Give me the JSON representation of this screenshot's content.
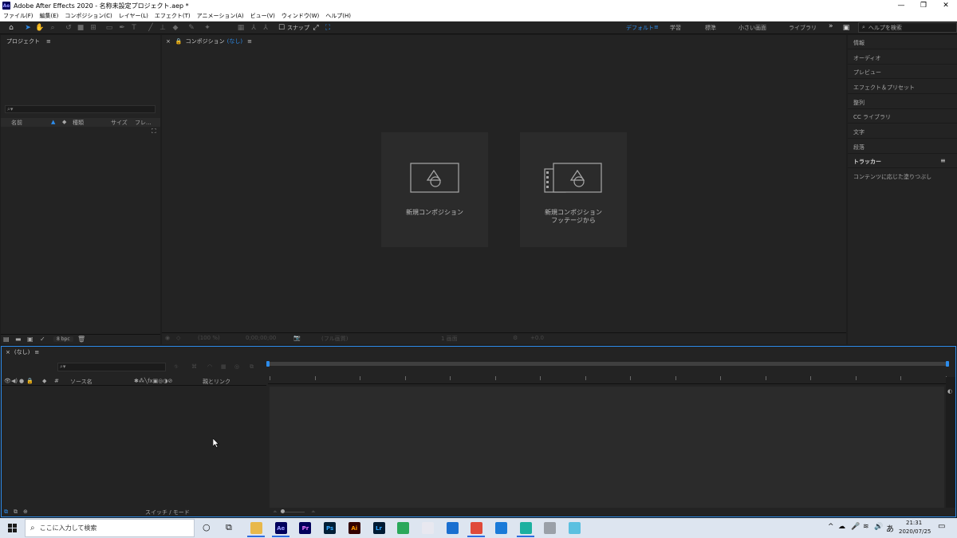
{
  "window": {
    "title": "Adobe After Effects 2020 - 名称未設定プロジェクト.aep *",
    "logo_text": "Ae",
    "controls": [
      "—",
      "❐",
      "✕"
    ]
  },
  "menu": [
    "ファイル(F)",
    "編集(E)",
    "コンポジション(C)",
    "レイヤー(L)",
    "エフェクト(T)",
    "アニメーション(A)",
    "ビュー(V)",
    "ウィンドウ(W)",
    "ヘルプ(H)"
  ],
  "toolbar": {
    "snap_label": "スナップ",
    "workspaces": [
      "デフォルト",
      "学習",
      "標準",
      "小さい画面",
      "ライブラリ"
    ],
    "active_workspace": "デフォルト",
    "help_search_placeholder": "ヘルプを検索"
  },
  "project": {
    "title": "プロジェクト",
    "columns": [
      "名前",
      "種類",
      "サイズ",
      "フレ..."
    ],
    "bpc": "8 bpc"
  },
  "composition": {
    "title": "コンポジション",
    "name": "(なし)",
    "new_comp_label": "新規コンポジション",
    "new_from_footage_line1": "新規コンポジション",
    "new_from_footage_line2": "フッテージから",
    "footer": {
      "zoom": "(100 %)",
      "timecode": "0;00;00;00",
      "resolution": "(フル画質)",
      "camera": "1 画面",
      "exposure": "+0.0"
    }
  },
  "right_panel": {
    "items": [
      "情報",
      "オーディオ",
      "プレビュー",
      "エフェクト＆プリセット",
      "整列",
      "CC ライブラリ",
      "文字",
      "段落"
    ],
    "tracker": "トラッカー",
    "content_aware": "コンテンツに応じた塗りつぶし"
  },
  "timeline": {
    "tab": "(なし)",
    "columns": [
      "ソース名",
      "親とリンク"
    ],
    "switch_mode": "スイッチ / モード"
  },
  "taskbar": {
    "search_placeholder": "ここに入力して検索",
    "time": "21:31",
    "date": "2020/07/25",
    "ime": "あ",
    "apps": [
      {
        "label": "",
        "color": "#e8b84a"
      },
      {
        "label": "Ae",
        "color": "#00005b"
      },
      {
        "label": "Pr",
        "color": "#00005b"
      },
      {
        "label": "Ps",
        "color": "#001e36"
      },
      {
        "label": "Ai",
        "color": "#330000"
      },
      {
        "label": "Lr",
        "color": "#001a33"
      },
      {
        "label": "",
        "color": "#2aa85a"
      },
      {
        "label": "",
        "color": "#e8e8f0"
      },
      {
        "label": "",
        "color": "#1a6fd0"
      },
      {
        "label": "",
        "color": "#e04a3a"
      },
      {
        "label": "",
        "color": "#1a7ad8"
      },
      {
        "label": "",
        "color": "#1cb0a0"
      },
      {
        "label": "",
        "color": "#9aa0a8"
      },
      {
        "label": "",
        "color": "#5ac0e0"
      }
    ]
  }
}
